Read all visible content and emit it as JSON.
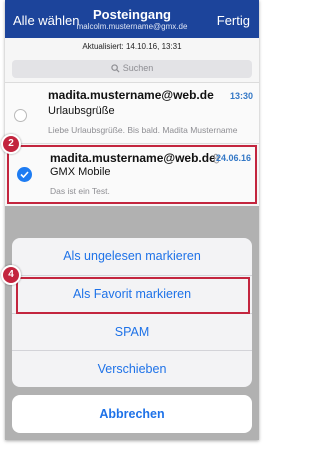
{
  "header": {
    "left_action": "Alle wählen",
    "title": "Posteingang",
    "account": "malcolm.mustername@gmx.de",
    "right_action": "Fertig"
  },
  "status": {
    "updated": "Aktualisiert: 14.10.16, 13:31"
  },
  "search": {
    "placeholder": "Suchen"
  },
  "mails": [
    {
      "sender": "madita.mustername@web.de",
      "subject": "Urlaubsgrüße",
      "preview": "Liebe Urlaubsgrüße. Bis bald. Madita Mustername",
      "date": "13:30",
      "selected": false
    },
    {
      "sender": "madita.mustername@web.de",
      "subject": "GMX Mobile",
      "preview": "Das ist ein Test.",
      "date": "24.06.16",
      "selected": true,
      "has_attachment": true
    }
  ],
  "action_sheet": {
    "actions": [
      "Als ungelesen markieren",
      "Als Favorit markieren",
      "SPAM",
      "Verschieben"
    ],
    "cancel": "Abbrechen"
  },
  "step_badges": [
    "2",
    "4"
  ],
  "colors": {
    "header": "#1c449b",
    "accent": "#1e72e8",
    "highlight": "#c3253e"
  }
}
